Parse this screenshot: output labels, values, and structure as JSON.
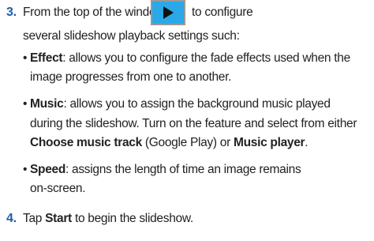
{
  "step3": {
    "number": "3.",
    "line1_before": "From the top of the window tap",
    "line1_after": "to configure",
    "line2": "several slideshow playback settings such:"
  },
  "bullets": {
    "effect": {
      "term": "Effect",
      "line1_rest": ": allows you to configure the fade effects used when the",
      "line2": "image progresses from one to another."
    },
    "music": {
      "term": "Music",
      "line1_rest": ": allows you to assign the background music played",
      "line2": "during the slideshow. Turn on the feature and select from either",
      "line3_bold1": "Choose music track",
      "line3_mid": " (Google Play) or ",
      "line3_bold2": "Music player",
      "line3_end": "."
    },
    "speed": {
      "term": "Speed",
      "line1_rest": ": assigns the length of time an image remains",
      "line2": "on-screen."
    },
    "bullet_char": "•"
  },
  "step4": {
    "number": "4.",
    "before": "Tap ",
    "bold": "Start",
    "after": " to begin the slideshow."
  },
  "icons": {
    "play_button": "play-icon",
    "play_bg_color": "#2aa8e8"
  }
}
